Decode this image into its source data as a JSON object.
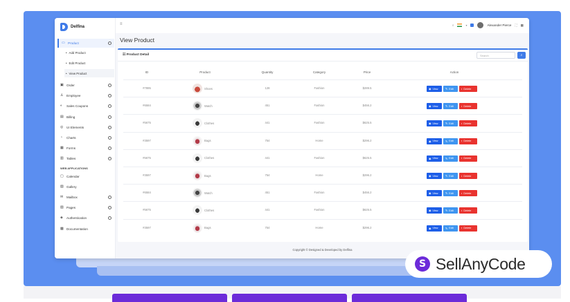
{
  "app": {
    "brand": "Delfina",
    "user_name": "Alexander Pierce",
    "page_title": "View Product",
    "card_title": "Product Detail",
    "search_placeholder": "Search",
    "copyright": "Copyright © Designed & Developed by Delfina"
  },
  "sidebar": {
    "items_top": [
      {
        "label": "Product",
        "icon": "tag-icon",
        "active": true
      }
    ],
    "sub_items": [
      {
        "label": "Add Product"
      },
      {
        "label": "Edit Product"
      },
      {
        "label": "View Product",
        "selected": true
      }
    ],
    "items": [
      {
        "label": "Order",
        "icon": "cart-icon",
        "chevron": true
      },
      {
        "label": "Employee",
        "icon": "user-icon",
        "chevron": true
      },
      {
        "label": "Sales Coupons",
        "icon": "coupon-icon",
        "chevron": true
      },
      {
        "label": "Billing",
        "icon": "billing-icon",
        "chevron": true
      },
      {
        "label": "UI Elements",
        "icon": "ui-icon",
        "chevron": true
      },
      {
        "label": "Charts",
        "icon": "chart-icon",
        "chevron": true
      },
      {
        "label": "Forms",
        "icon": "form-icon",
        "chevron": true
      },
      {
        "label": "Tables",
        "icon": "table-icon",
        "chevron": true
      }
    ],
    "section_heading": "WEB APPLICATIONS",
    "apps": [
      {
        "label": "Calendar",
        "icon": "calendar-icon",
        "chevron": false
      },
      {
        "label": "Gallery",
        "icon": "gallery-icon",
        "chevron": false
      },
      {
        "label": "Mailbox",
        "icon": "mail-icon",
        "chevron": true
      },
      {
        "label": "Pages",
        "icon": "pages-icon",
        "chevron": true
      },
      {
        "label": "Authentication",
        "icon": "lock-icon",
        "chevron": true
      },
      {
        "label": "Documentation",
        "icon": "doc-icon",
        "chevron": false
      }
    ]
  },
  "table": {
    "headers": [
      "ID",
      "Product",
      "Quantity",
      "Category",
      "Price",
      "Action"
    ],
    "actions": {
      "view": "View",
      "edit": "Edit",
      "delete": "Delete"
    },
    "rows": [
      {
        "id": "#7895",
        "product": "Shoes",
        "qty": "128",
        "category": "Fashion",
        "price": "$289.5",
        "img": "shoes"
      },
      {
        "id": "#6584",
        "product": "Watch",
        "qty": "451",
        "category": "Fashion",
        "price": "$456.2",
        "img": "watch"
      },
      {
        "id": "#5675",
        "product": "Clothes",
        "qty": "441",
        "category": "Fashion",
        "price": "$625.5",
        "img": "clothes"
      },
      {
        "id": "#3597",
        "product": "Bags",
        "qty": "754",
        "category": "Home",
        "price": "$296.2",
        "img": "bags"
      },
      {
        "id": "#5675",
        "product": "Clothes",
        "qty": "441",
        "category": "Fashion",
        "price": "$625.5",
        "img": "clothes"
      },
      {
        "id": "#3597",
        "product": "Bags",
        "qty": "754",
        "category": "Home",
        "price": "$296.2",
        "img": "bags"
      },
      {
        "id": "#6584",
        "product": "Watch",
        "qty": "451",
        "category": "Fashion",
        "price": "$456.2",
        "img": "watch"
      },
      {
        "id": "#5675",
        "product": "Clothes",
        "qty": "441",
        "category": "Fashion",
        "price": "$625.5",
        "img": "clothes"
      },
      {
        "id": "#3597",
        "product": "Bags",
        "qty": "754",
        "category": "Home",
        "price": "$296.2",
        "img": "bags"
      }
    ]
  },
  "watermark": {
    "text": "SellAnyCode"
  },
  "colors": {
    "primary": "#3f7be8",
    "panel": "#5b8ef0",
    "danger": "#e9332f",
    "brand_purple": "#6c2bd9"
  }
}
